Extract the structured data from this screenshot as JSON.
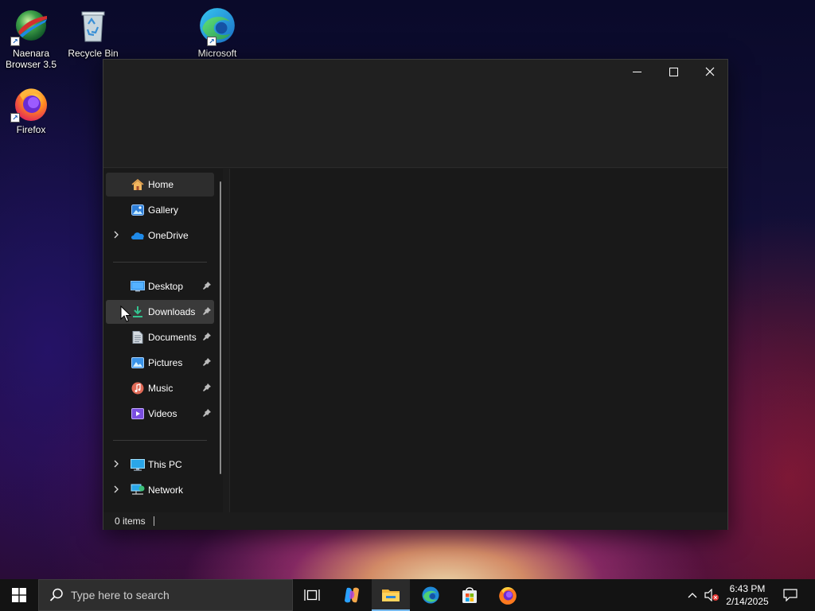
{
  "desktop": {
    "icons": [
      {
        "label_line1": "Naenara",
        "label_line2": "Browser 3.5",
        "icon": "naenara-browser-icon"
      },
      {
        "label": "Recycle Bin",
        "icon": "recycle-bin-icon"
      },
      {
        "label": "Microsoft",
        "icon": "edge-icon"
      },
      {
        "label": "Firefox",
        "icon": "firefox-icon"
      }
    ]
  },
  "explorer": {
    "controls": {
      "minimize": "─",
      "maximize": "☐",
      "close": "✕"
    },
    "nav": {
      "items": [
        {
          "label": "Home",
          "icon": "home-icon"
        },
        {
          "label": "Gallery",
          "icon": "gallery-icon"
        },
        {
          "label": "OneDrive",
          "icon": "onedrive-icon"
        },
        {
          "label": "Desktop",
          "icon": "desktop-folder-icon"
        },
        {
          "label": "Downloads",
          "icon": "downloads-icon"
        },
        {
          "label": "Documents",
          "icon": "documents-icon"
        },
        {
          "label": "Pictures",
          "icon": "pictures-icon"
        },
        {
          "label": "Music",
          "icon": "music-icon"
        },
        {
          "label": "Videos",
          "icon": "videos-icon"
        },
        {
          "label": "This PC",
          "icon": "this-pc-icon"
        },
        {
          "label": "Network",
          "icon": "network-icon"
        }
      ]
    },
    "status": {
      "items_count": "0 items"
    }
  },
  "taskbar": {
    "search_placeholder": "Type here to search",
    "apps": [
      "task-view-icon",
      "copilot-icon",
      "file-explorer-icon",
      "edge-icon",
      "microsoft-store-icon",
      "firefox-icon"
    ],
    "active_app": "file-explorer-icon",
    "tray": {
      "time": "6:43 PM",
      "date": "2/14/2025"
    }
  },
  "colors": {
    "accent": "#76b9ed",
    "window_bg": "#1c1c1c",
    "taskbar_bg": "#131313"
  }
}
